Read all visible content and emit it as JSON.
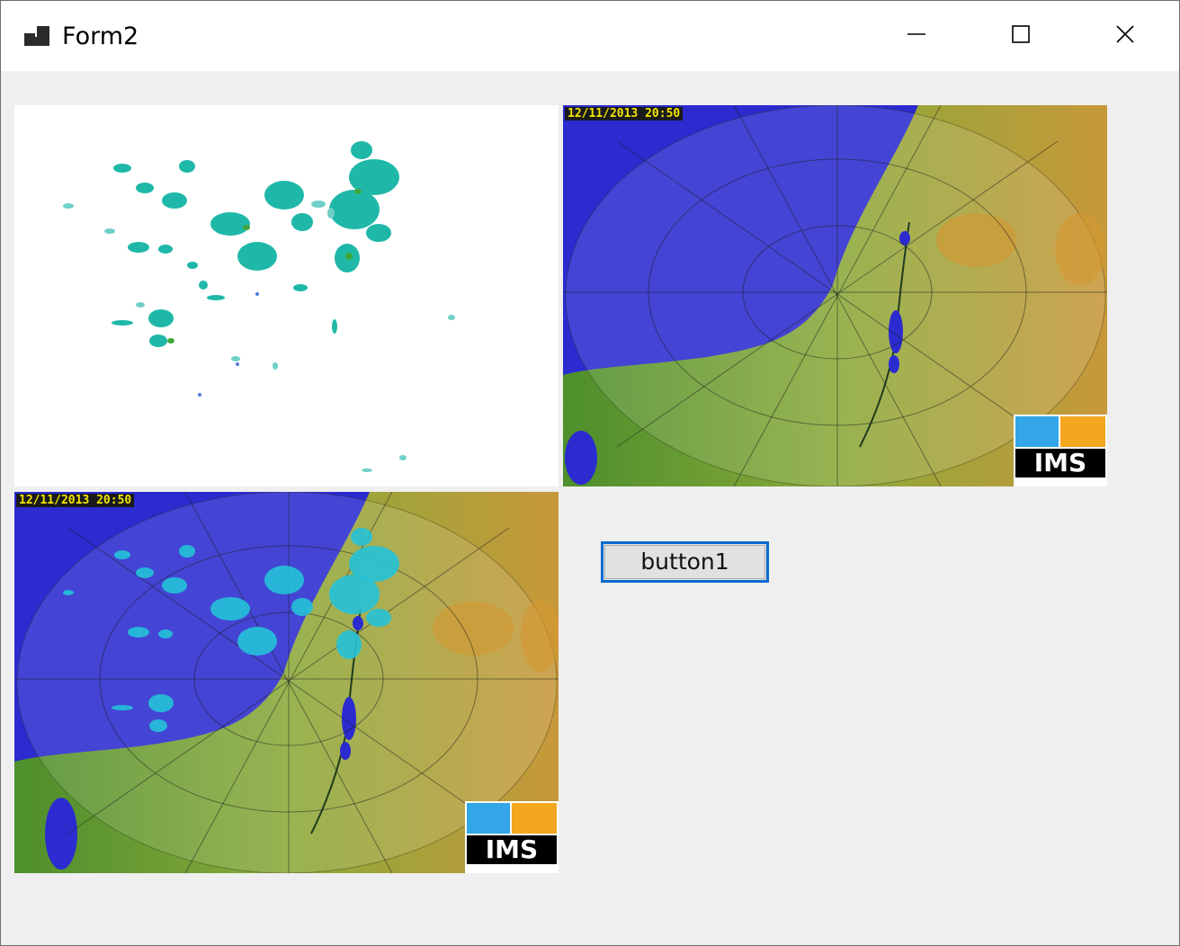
{
  "window": {
    "title": "Form2",
    "icons": {
      "app": "app-window-icon",
      "minimize": "minimize-icon",
      "maximize": "maximize-icon",
      "close": "close-icon"
    }
  },
  "pictures": {
    "radar_overlay": {
      "name": "radar-echo-overlay"
    },
    "radar_base": {
      "timestamp": "12/11/2013 20:50",
      "logo": "IMS"
    },
    "radar_combined": {
      "timestamp": "12/11/2013 20:50",
      "logo": "IMS"
    }
  },
  "button1": {
    "label": "button1"
  },
  "colors": {
    "sea": "#2f2fd2",
    "land": "#8fae3a",
    "echo": "#1fb8a8",
    "focus_border": "#0a6ad2"
  }
}
